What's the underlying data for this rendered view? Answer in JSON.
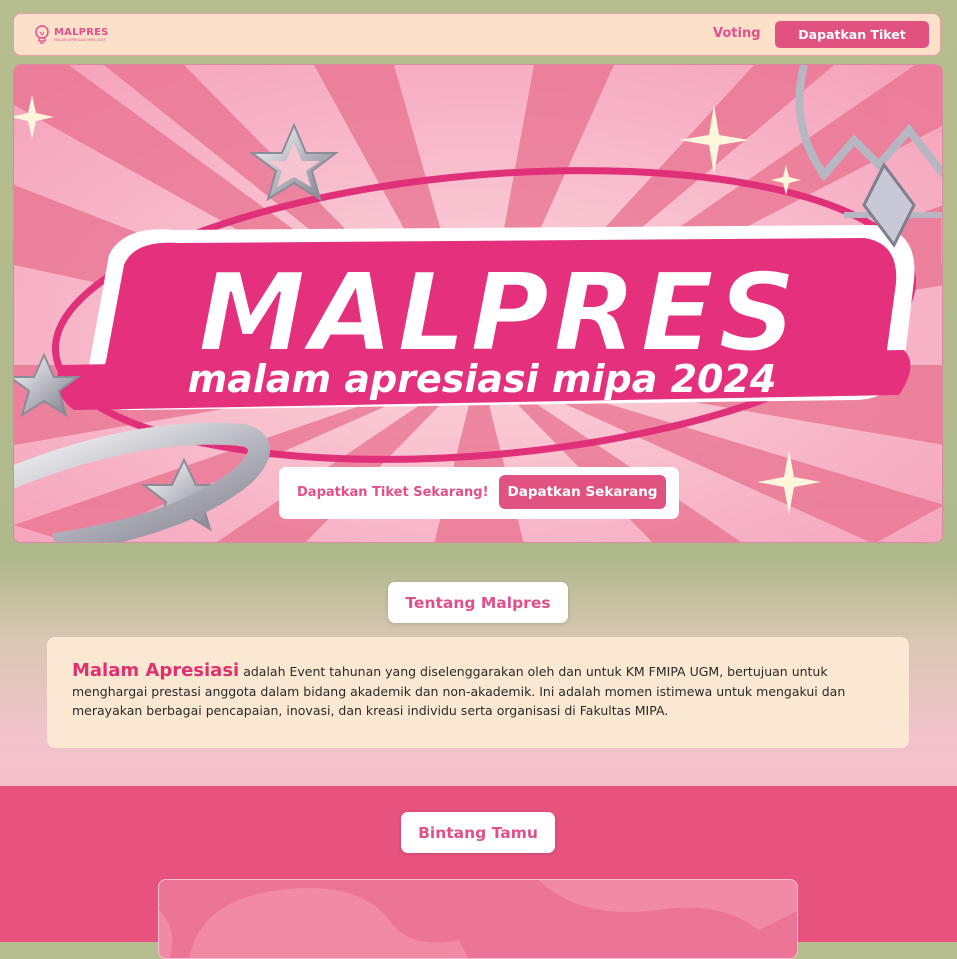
{
  "navbar": {
    "logo_name": "MALPRES",
    "logo_sub": "MALAM APRESIASI MIPA 2024",
    "voting_label": "Voting",
    "ticket_label": "Dapatkan Tiket"
  },
  "hero": {
    "title": "MALPRES",
    "subtitle": "malam apresiasi mipa 2024",
    "cta_text": "Dapatkan Tiket Sekarang!",
    "cta_button": "Dapatkan Sekarang"
  },
  "about": {
    "heading": "Tentang Malpres",
    "highlight": "Malam Apresiasi",
    "body": " adalah Event tahunan yang diselenggarakan oleh dan untuk KM FMIPA UGM, bertujuan untuk menghargai prestasi anggota dalam bidang akademik dan non-akademik. Ini adalah momen istimewa untuk mengakui dan merayakan berbagai pencapaian, inovasi, dan kreasi individu serta organisasi di Fakultas MIPA."
  },
  "guest": {
    "heading": "Bintang Tamu"
  },
  "colors": {
    "accent": "#e0527f",
    "pink_text": "#e0508a",
    "navbar_bg": "#fde0ca",
    "card_bg": "#fbe8d3",
    "guest_bg": "#e8527f"
  }
}
